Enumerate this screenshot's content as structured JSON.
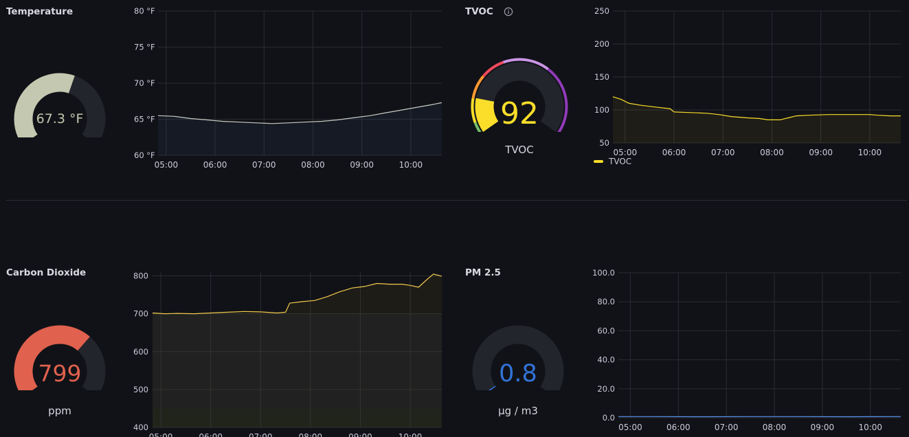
{
  "panels": {
    "temperature": {
      "title": "Temperature",
      "gauge": {
        "value": 67.3,
        "display": "67.3 °F",
        "min": 50,
        "max": 80,
        "color": "#c4c8b0"
      },
      "chart_data": {
        "type": "area",
        "ylim": [
          60,
          80
        ],
        "yticks": [
          60,
          65,
          70,
          75,
          80
        ],
        "ytick_labels": [
          "60 °F",
          "65 °F",
          "70 °F",
          "75 °F",
          "80 °F"
        ],
        "xlim": [
          "04:50",
          "10:38"
        ],
        "xticks": [
          "05:00",
          "06:00",
          "07:00",
          "08:00",
          "09:00",
          "10:00"
        ],
        "series": [
          {
            "color": "#c7cdc4",
            "points": [
              [
                "04:50",
                65.5
              ],
              [
                "05:10",
                65.4
              ],
              [
                "05:30",
                65.1
              ],
              [
                "05:50",
                64.9
              ],
              [
                "06:10",
                64.7
              ],
              [
                "06:30",
                64.6
              ],
              [
                "06:50",
                64.5
              ],
              [
                "07:10",
                64.4
              ],
              [
                "07:30",
                64.5
              ],
              [
                "07:50",
                64.6
              ],
              [
                "08:10",
                64.7
              ],
              [
                "08:30",
                64.9
              ],
              [
                "08:50",
                65.2
              ],
              [
                "09:10",
                65.5
              ],
              [
                "09:30",
                65.9
              ],
              [
                "09:50",
                66.3
              ],
              [
                "10:10",
                66.7
              ],
              [
                "10:25",
                67.0
              ],
              [
                "10:38",
                67.3
              ]
            ]
          }
        ]
      }
    },
    "tvoc": {
      "title": "TVOC",
      "gauge": {
        "value": 92,
        "display": "92",
        "label": "TVOC",
        "min": 0,
        "max": 500,
        "color": "#fade2a"
      },
      "chart_data": {
        "type": "area",
        "ylim": [
          50,
          250
        ],
        "yticks": [
          50,
          100,
          150,
          200,
          250
        ],
        "ytick_labels": [
          "50",
          "100",
          "150",
          "200",
          "250"
        ],
        "xlim": [
          "04:45",
          "10:38"
        ],
        "xticks": [
          "05:00",
          "06:00",
          "07:00",
          "08:00",
          "09:00",
          "10:00"
        ],
        "legend": [
          "TVOC"
        ],
        "series": [
          {
            "name": "TVOC",
            "color": "#fade2a",
            "points": [
              [
                "04:45",
                120
              ],
              [
                "04:55",
                116
              ],
              [
                "05:05",
                110
              ],
              [
                "05:20",
                107
              ],
              [
                "05:40",
                104
              ],
              [
                "05:55",
                102
              ],
              [
                "06:00",
                97
              ],
              [
                "06:20",
                96
              ],
              [
                "06:40",
                95
              ],
              [
                "06:55",
                93
              ],
              [
                "07:10",
                90
              ],
              [
                "07:30",
                88
              ],
              [
                "07:45",
                87
              ],
              [
                "07:55",
                85
              ],
              [
                "08:10",
                85
              ],
              [
                "08:20",
                88
              ],
              [
                "08:30",
                91
              ],
              [
                "08:45",
                92
              ],
              [
                "09:10",
                93
              ],
              [
                "09:40",
                93
              ],
              [
                "10:00",
                93
              ],
              [
                "10:10",
                92
              ],
              [
                "10:25",
                91
              ],
              [
                "10:38",
                91
              ]
            ]
          }
        ]
      }
    },
    "co2": {
      "title": "Carbon Dioxide",
      "gauge": {
        "value": 799,
        "display": "799",
        "label": "ppm",
        "min": 400,
        "max": 1000,
        "color": "#e0614e"
      },
      "chart_data": {
        "type": "area",
        "ylim": [
          400,
          810
        ],
        "yticks": [
          400,
          500,
          600,
          700,
          800
        ],
        "ytick_labels": [
          "400",
          "500",
          "600",
          "700",
          "800"
        ],
        "xlim": [
          "04:50",
          "10:38"
        ],
        "xticks": [
          "05:00",
          "06:00",
          "07:00",
          "08:00",
          "09:00",
          "10:00"
        ],
        "series": [
          {
            "color": "#f2c94c",
            "points": [
              [
                "04:50",
                702
              ],
              [
                "05:05",
                700
              ],
              [
                "05:20",
                701
              ],
              [
                "05:40",
                700
              ],
              [
                "06:00",
                702
              ],
              [
                "06:20",
                704
              ],
              [
                "06:40",
                706
              ],
              [
                "07:00",
                705
              ],
              [
                "07:20",
                702
              ],
              [
                "07:30",
                704
              ],
              [
                "07:35",
                728
              ],
              [
                "07:50",
                732
              ],
              [
                "08:05",
                735
              ],
              [
                "08:20",
                745
              ],
              [
                "08:35",
                758
              ],
              [
                "08:50",
                768
              ],
              [
                "09:05",
                772
              ],
              [
                "09:20",
                780
              ],
              [
                "09:35",
                778
              ],
              [
                "09:50",
                778
              ],
              [
                "10:00",
                775
              ],
              [
                "10:10",
                770
              ],
              [
                "10:20",
                790
              ],
              [
                "10:28",
                805
              ],
              [
                "10:38",
                799
              ]
            ]
          }
        ]
      }
    },
    "pm25": {
      "title": "PM 2.5",
      "gauge": {
        "value": 0.8,
        "display": "0.8",
        "label": "µg / m3",
        "min": 0,
        "max": 100,
        "color": "#3274d9"
      },
      "chart_data": {
        "type": "line",
        "ylim": [
          0,
          100
        ],
        "yticks": [
          0,
          20,
          40,
          60,
          80,
          100
        ],
        "ytick_labels": [
          "0.0",
          "20.0",
          "40.0",
          "60.0",
          "80.0",
          "100.0"
        ],
        "xlim": [
          "04:45",
          "10:38"
        ],
        "xticks": [
          "05:00",
          "06:00",
          "07:00",
          "08:00",
          "09:00",
          "10:00"
        ],
        "series": [
          {
            "color": "#5794f2",
            "points": [
              [
                "04:45",
                0.8
              ],
              [
                "05:30",
                0.8
              ],
              [
                "06:30",
                0.7
              ],
              [
                "07:30",
                0.8
              ],
              [
                "08:30",
                0.8
              ],
              [
                "09:30",
                0.7
              ],
              [
                "10:38",
                0.8
              ]
            ]
          }
        ]
      }
    }
  }
}
